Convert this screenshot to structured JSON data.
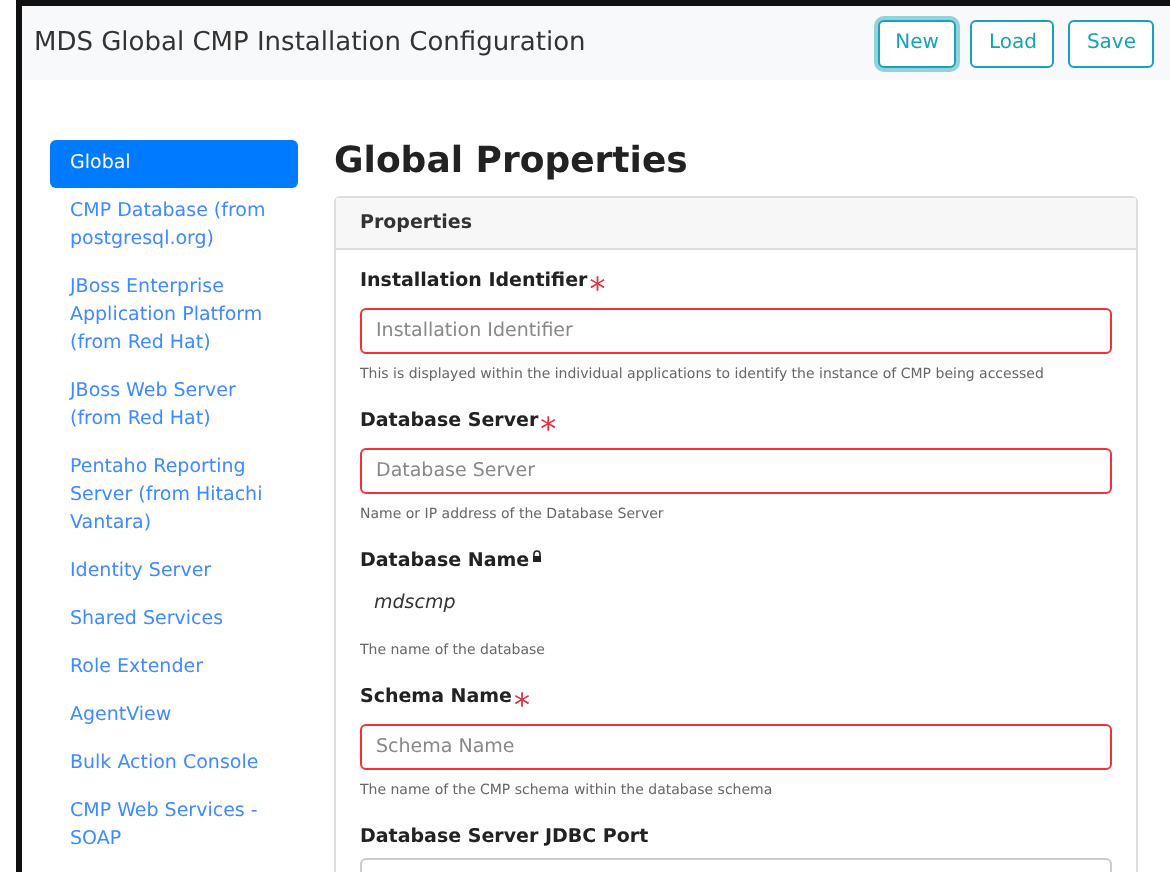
{
  "header": {
    "title": "MDS Global CMP Installation Configuration",
    "buttons": [
      {
        "label": "New",
        "focused": true
      },
      {
        "label": "Load",
        "focused": false
      },
      {
        "label": "Save",
        "focused": false
      }
    ]
  },
  "sidebar": {
    "items": [
      {
        "label": "Global",
        "selected": true
      },
      {
        "label": "CMP Database (from postgresql.org)",
        "selected": false
      },
      {
        "label": "JBoss Enterprise Application Platform (from Red Hat)",
        "selected": false
      },
      {
        "label": "JBoss Web Server (from Red Hat)",
        "selected": false
      },
      {
        "label": "Pentaho Reporting Server (from Hitachi Vantara)",
        "selected": false
      },
      {
        "label": "Identity Server",
        "selected": false
      },
      {
        "label": "Shared Services",
        "selected": false
      },
      {
        "label": "Role Extender",
        "selected": false
      },
      {
        "label": "AgentView",
        "selected": false
      },
      {
        "label": "Bulk Action Console",
        "selected": false
      },
      {
        "label": "CMP Web Services - SOAP",
        "selected": false
      }
    ]
  },
  "content": {
    "heading": "Global Properties",
    "card_title": "Properties",
    "fields": [
      {
        "kind": "input",
        "label": "Installation Identifier",
        "marker": "*",
        "invalid": true,
        "placeholder": "Installation Identifier",
        "help": "This is displayed within the individual applications to identify the instance of CMP being accessed"
      },
      {
        "kind": "input",
        "label": "Database Server",
        "marker": "*",
        "invalid": true,
        "placeholder": "Database Server",
        "help": "Name or IP address of the Database Server"
      },
      {
        "kind": "readonly",
        "label": "Database Name",
        "locked": true,
        "value": "mdscmp",
        "help": "The name of the database"
      },
      {
        "kind": "input",
        "label": "Schema Name",
        "marker": "*",
        "invalid": true,
        "placeholder": "Schema Name",
        "help": "The name of the CMP schema within the database schema"
      },
      {
        "kind": "input",
        "label": "Database Server JDBC Port",
        "invalid": false
      }
    ]
  }
}
